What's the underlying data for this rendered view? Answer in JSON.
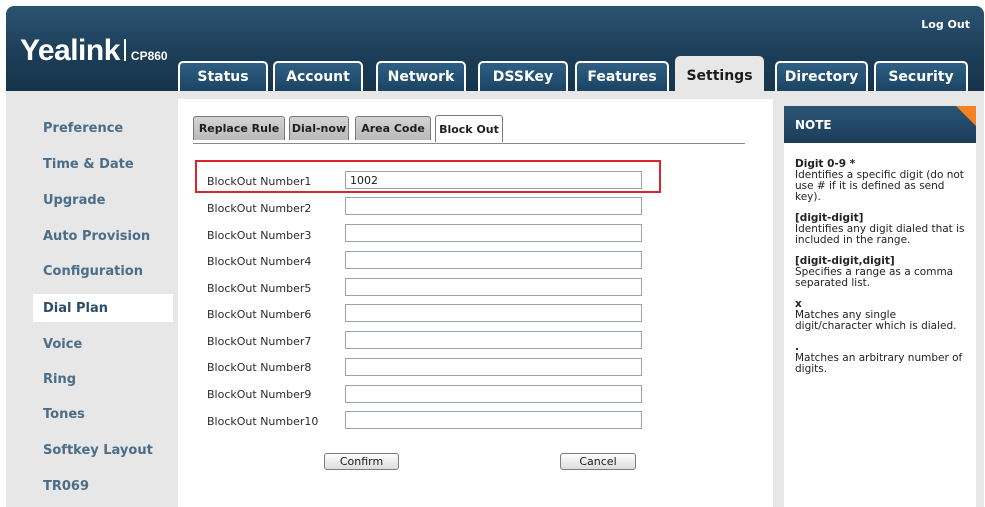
{
  "header": {
    "logout": "Log Out",
    "brand": "Yealink",
    "model": "CP860",
    "tabs": [
      "Status",
      "Account",
      "Network",
      "DSSKey",
      "Features",
      "Settings",
      "Directory",
      "Security"
    ],
    "active_tab": "Settings"
  },
  "sidebar": {
    "items": [
      "Preference",
      "Time & Date",
      "Upgrade",
      "Auto Provision",
      "Configuration",
      "Dial Plan",
      "Voice",
      "Ring",
      "Tones",
      "Softkey Layout",
      "TR069"
    ],
    "active": "Dial Plan"
  },
  "subtabs": {
    "items": [
      "Replace Rule",
      "Dial-now",
      "Area Code",
      "Block Out"
    ],
    "active": "Block Out"
  },
  "form": {
    "rows": [
      {
        "label": "BlockOut Number1",
        "value": "1002"
      },
      {
        "label": "BlockOut Number2",
        "value": ""
      },
      {
        "label": "BlockOut Number3",
        "value": ""
      },
      {
        "label": "BlockOut Number4",
        "value": ""
      },
      {
        "label": "BlockOut Number5",
        "value": ""
      },
      {
        "label": "BlockOut Number6",
        "value": ""
      },
      {
        "label": "BlockOut Number7",
        "value": ""
      },
      {
        "label": "BlockOut Number8",
        "value": ""
      },
      {
        "label": "BlockOut Number9",
        "value": ""
      },
      {
        "label": "BlockOut Number10",
        "value": ""
      }
    ],
    "confirm": "Confirm",
    "cancel": "Cancel"
  },
  "note": {
    "title": "NOTE",
    "entries": [
      {
        "term": "Digit 0-9 *",
        "desc": "Identifies a specific digit (do not use # if it is defined as send key)."
      },
      {
        "term": "[digit-digit]",
        "desc": "Identifies any digit dialed that is included in the range."
      },
      {
        "term": "[digit-digit,digit]",
        "desc": "Specifies a range as a comma separated list."
      },
      {
        "term": "x",
        "desc": "Matches any single digit/character which is dialed."
      },
      {
        "term": ".",
        "desc": "Matches an arbitrary number of digits."
      }
    ]
  },
  "colors": {
    "header": "#1d3e58",
    "sidebar_text": "#4b6d88",
    "highlight": "#d9262d",
    "accent_corner": "#f58220"
  }
}
